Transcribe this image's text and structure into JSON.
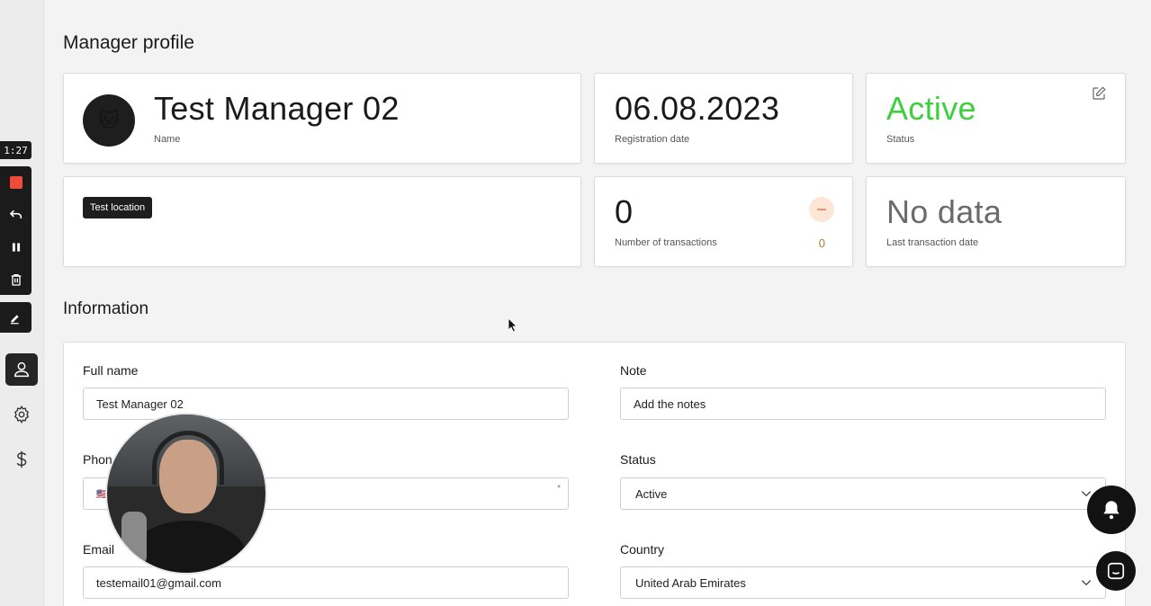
{
  "recorder": {
    "timer": "1:27"
  },
  "page": {
    "title": "Manager profile"
  },
  "cards": {
    "name": {
      "value": "Test Manager 02",
      "label": "Name",
      "avatar_emoji": "🐱"
    },
    "registration": {
      "value": "06.08.2023",
      "label": "Registration date"
    },
    "status": {
      "value": "Active",
      "label": "Status",
      "color": "#3ecf3e"
    },
    "location": {
      "badge": "Test location"
    },
    "transactions": {
      "value": "0",
      "label": "Number of transactions",
      "secondary": "0"
    },
    "last_transaction": {
      "value": "No data",
      "label": "Last transaction date"
    }
  },
  "information": {
    "title": "Information",
    "full_name": {
      "label": "Full name",
      "value": "Test Manager 02"
    },
    "phone": {
      "label": "Phon",
      "flag": "🇺🇸",
      "required_mark": "*"
    },
    "email": {
      "label": "Email",
      "value": "testemail01@gmail.com"
    },
    "note": {
      "label": "Note",
      "placeholder": "Add the notes"
    },
    "status": {
      "label": "Status",
      "value": "Active"
    },
    "country": {
      "label": "Country",
      "value": "United Arab Emirates"
    }
  },
  "icons": {
    "sidebar": [
      "user-icon",
      "gear-icon",
      "dollar-icon"
    ],
    "recorder": [
      "stop-icon",
      "undo-icon",
      "pause-icon",
      "trash-icon",
      "pen-icon"
    ]
  }
}
